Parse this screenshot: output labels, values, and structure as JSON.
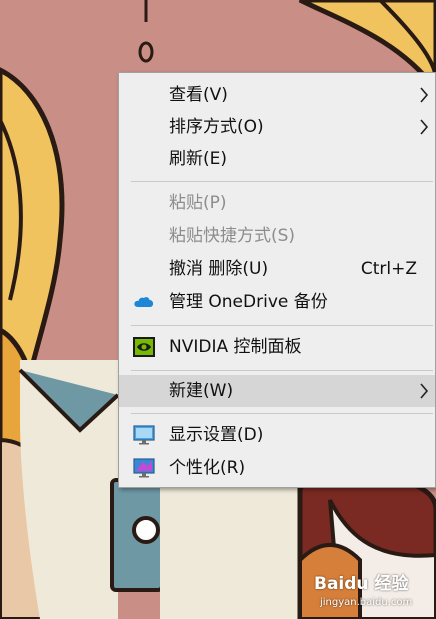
{
  "menu": {
    "items": [
      {
        "label": "查看(V)",
        "has_submenu": true
      },
      {
        "label": "排序方式(O)",
        "has_submenu": true
      },
      {
        "label": "刷新(E)"
      },
      {
        "label": "粘贴(P)",
        "disabled": true
      },
      {
        "label": "粘贴快捷方式(S)",
        "disabled": true
      },
      {
        "label": "撤消 删除(U)",
        "shortcut": "Ctrl+Z"
      },
      {
        "label": "管理 OneDrive 备份",
        "icon": "onedrive-cloud-icon"
      },
      {
        "label": "NVIDIA 控制面板",
        "icon": "nvidia-icon"
      },
      {
        "label": "新建(W)",
        "has_submenu": true,
        "highlighted": true
      },
      {
        "label": "显示设置(D)",
        "icon": "display-settings-icon"
      },
      {
        "label": "个性化(R)",
        "icon": "personalize-icon"
      }
    ]
  },
  "watermark": {
    "title": "Baidu 经验",
    "url": "jingyan.baidu.com"
  },
  "colors": {
    "menu_bg": "#eeeeee",
    "highlight_bg": "#d6d6d6",
    "disabled_text": "#8d8d8d",
    "wallpaper_pink": "#c98f86"
  }
}
